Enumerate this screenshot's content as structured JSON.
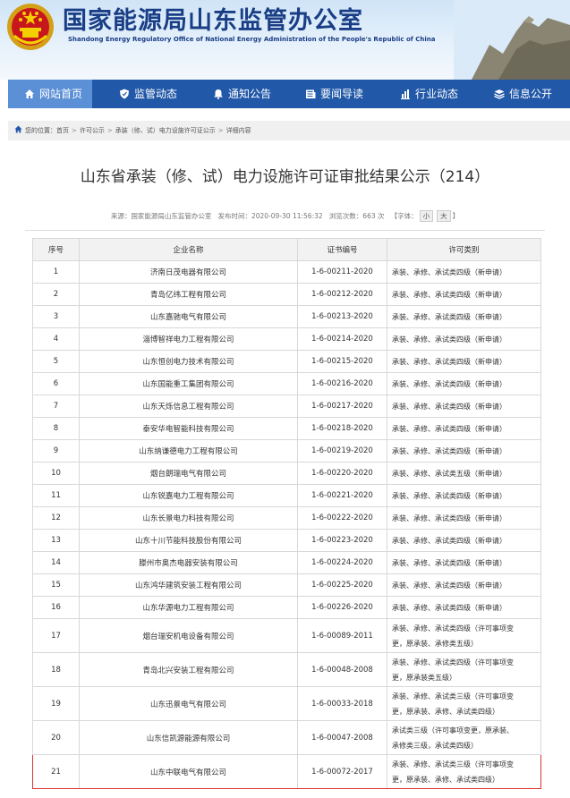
{
  "header": {
    "site_title": "国家能源局山东监管办公室",
    "site_subtitle": "Shandong Energy Regulatory Office of National Energy Administration of the People's Republic of China"
  },
  "nav": [
    {
      "label": "网站首页",
      "icon": "home-icon",
      "active": true
    },
    {
      "label": "监管动态",
      "icon": "shield-icon",
      "active": false
    },
    {
      "label": "通知公告",
      "icon": "bell-icon",
      "active": false
    },
    {
      "label": "要闻导读",
      "icon": "newspaper-icon",
      "active": false
    },
    {
      "label": "行业动态",
      "icon": "bar-chart-icon",
      "active": false
    },
    {
      "label": "信息公开",
      "icon": "layers-icon",
      "active": false
    }
  ],
  "breadcrumb": {
    "prefix": "您的位置：",
    "items": [
      "首页",
      "许可公示",
      "承装（修、试）电力设施许可证公示",
      "详细内容"
    ]
  },
  "article": {
    "title": "山东省承装（修、试）电力设施许可证审批结果公示（214）",
    "source": "来源：国家能源局山东监管办公室",
    "publish_time": "发布时间：2020-09-30 11:56:32",
    "views": "浏览次数：663 次",
    "font_label": "【字体：",
    "font_small": "小",
    "font_large": "大",
    "font_close": "】"
  },
  "table": {
    "headers": [
      "序号",
      "企业名称",
      "证书编号",
      "许可类别"
    ],
    "rows": [
      {
        "no": "1",
        "company": "济南日茂电器有限公司",
        "cert": "1-6-00211-2020",
        "category": "承装、承修、承试类四级（新申请）"
      },
      {
        "no": "2",
        "company": "青岛亿纬工程有限公司",
        "cert": "1-6-00212-2020",
        "category": "承装、承修、承试类四级（新申请）"
      },
      {
        "no": "3",
        "company": "山东嘉驰电气有限公司",
        "cert": "1-6-00213-2020",
        "category": "承装、承修、承试类四级（新申请）"
      },
      {
        "no": "4",
        "company": "淄博智祥电力工程有限公司",
        "cert": "1-6-00214-2020",
        "category": "承装、承修、承试类四级（新申请）"
      },
      {
        "no": "5",
        "company": "山东恒创电力技术有限公司",
        "cert": "1-6-00215-2020",
        "category": "承装、承修、承试类四级（新申请）"
      },
      {
        "no": "6",
        "company": "山东国能重工集团有限公司",
        "cert": "1-6-00216-2020",
        "category": "承装、承修、承试类四级（新申请）"
      },
      {
        "no": "7",
        "company": "山东天烁信息工程有限公司",
        "cert": "1-6-00217-2020",
        "category": "承装、承修、承试类四级（新申请）"
      },
      {
        "no": "8",
        "company": "泰安华电智能科技有限公司",
        "cert": "1-6-00218-2020",
        "category": "承装、承修、承试类四级（新申请）"
      },
      {
        "no": "9",
        "company": "山东纳谦德电力工程有限公司",
        "cert": "1-6-00219-2020",
        "category": "承装、承修、承试类四级（新申请）"
      },
      {
        "no": "10",
        "company": "烟台朗瑞电气有限公司",
        "cert": "1-6-00220-2020",
        "category": "承装、承修、承试类五级（新申请）"
      },
      {
        "no": "11",
        "company": "山东锐嘉电力工程有限公司",
        "cert": "1-6-00221-2020",
        "category": "承装、承修、承试类四级（新申请）"
      },
      {
        "no": "12",
        "company": "山东长景电力科技有限公司",
        "cert": "1-6-00222-2020",
        "category": "承装、承修、承试类四级（新申请）"
      },
      {
        "no": "13",
        "company": "山东十川节能科技股份有限公司",
        "cert": "1-6-00223-2020",
        "category": "承装、承修、承试类四级（新申请）"
      },
      {
        "no": "14",
        "company": "滕州市奥杰电器安装有限公司",
        "cert": "1-6-00224-2020",
        "category": "承装、承修、承试类四级（新申请）"
      },
      {
        "no": "15",
        "company": "山东鸿华建筑安装工程有限公司",
        "cert": "1-6-00225-2020",
        "category": "承装、承修、承试类四级（新申请）"
      },
      {
        "no": "16",
        "company": "山东华源电力工程有限公司",
        "cert": "1-6-00226-2020",
        "category": "承装、承修、承试类四级（新申请）"
      },
      {
        "no": "17",
        "company": "烟台瑞安机电设备有限公司",
        "cert": "1-6-00089-2011",
        "category_lines": [
          "承装、承修、承试类四级（许可事项变",
          "更，原承装、承修类五级）"
        ]
      },
      {
        "no": "18",
        "company": "青岛北兴安装工程有限公司",
        "cert": "1-6-00048-2008",
        "category_lines": [
          "承装、承修、承试类四级（许可事项变",
          "更，原承装类五级）"
        ]
      },
      {
        "no": "19",
        "company": "山东迅景电气有限公司",
        "cert": "1-6-00033-2018",
        "category_lines": [
          "承装、承修、承试类三级（许可事项变",
          "更，原承装、承修、承试类四级）"
        ]
      },
      {
        "no": "20",
        "company": "山东信凯源能源有限公司",
        "cert": "1-6-00047-2008",
        "category_lines": [
          "承试类三级（许可事项变更，原承装、",
          "承修类三级，承试类四级）"
        ]
      },
      {
        "no": "21",
        "company": "山东中联电气有限公司",
        "cert": "1-6-00072-2017",
        "category_lines": [
          "承装、承修、承试类三级（许可事项变",
          "更，原承装、承修、承试类四级）"
        ],
        "highlighted": true
      }
    ]
  }
}
